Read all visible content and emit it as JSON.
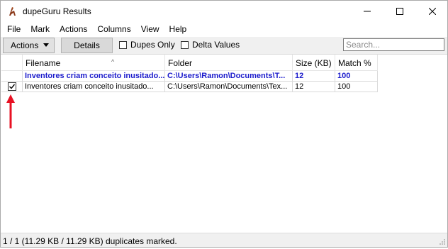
{
  "window": {
    "title": "dupeGuru Results",
    "icon": "dupeguru-app-icon",
    "controls": [
      "minimize-icon",
      "maximize-icon",
      "close-icon"
    ]
  },
  "menu": {
    "file": "File",
    "mark": "Mark",
    "actions": "Actions",
    "columns": "Columns",
    "view": "View",
    "help": "Help"
  },
  "toolbar": {
    "actions_label": "Actions",
    "details_label": "Details",
    "dupes_only_label": "Dupes Only",
    "dupes_only_checked": false,
    "delta_values_label": "Delta Values",
    "delta_values_checked": false,
    "search_placeholder": "Search...",
    "search_value": ""
  },
  "table": {
    "columns": [
      "Filename",
      "Folder",
      "Size (KB)",
      "Match %"
    ],
    "sorted_column": "Filename",
    "rows": [
      {
        "reference": true,
        "checked": false,
        "filename": "Inventores criam conceito inusitado...",
        "folder": "C:\\Users\\Ramon\\Documents\\T...",
        "size": "12",
        "match": "100"
      },
      {
        "reference": false,
        "checked": true,
        "filename": "Inventores criam conceito inusitado...",
        "folder": "C:\\Users\\Ramon\\Documents\\Tex...",
        "size": "12",
        "match": "100"
      }
    ]
  },
  "annotation": {
    "icon": "red-up-arrow-icon",
    "color": "#e81123"
  },
  "status": {
    "text": "1 / 1 (11.29 KB / 11.29 KB) duplicates marked."
  },
  "colors": {
    "reference_row": "#1c1ccc",
    "toolbar_bg": "#f0f0f0",
    "arrow": "#e81123"
  }
}
